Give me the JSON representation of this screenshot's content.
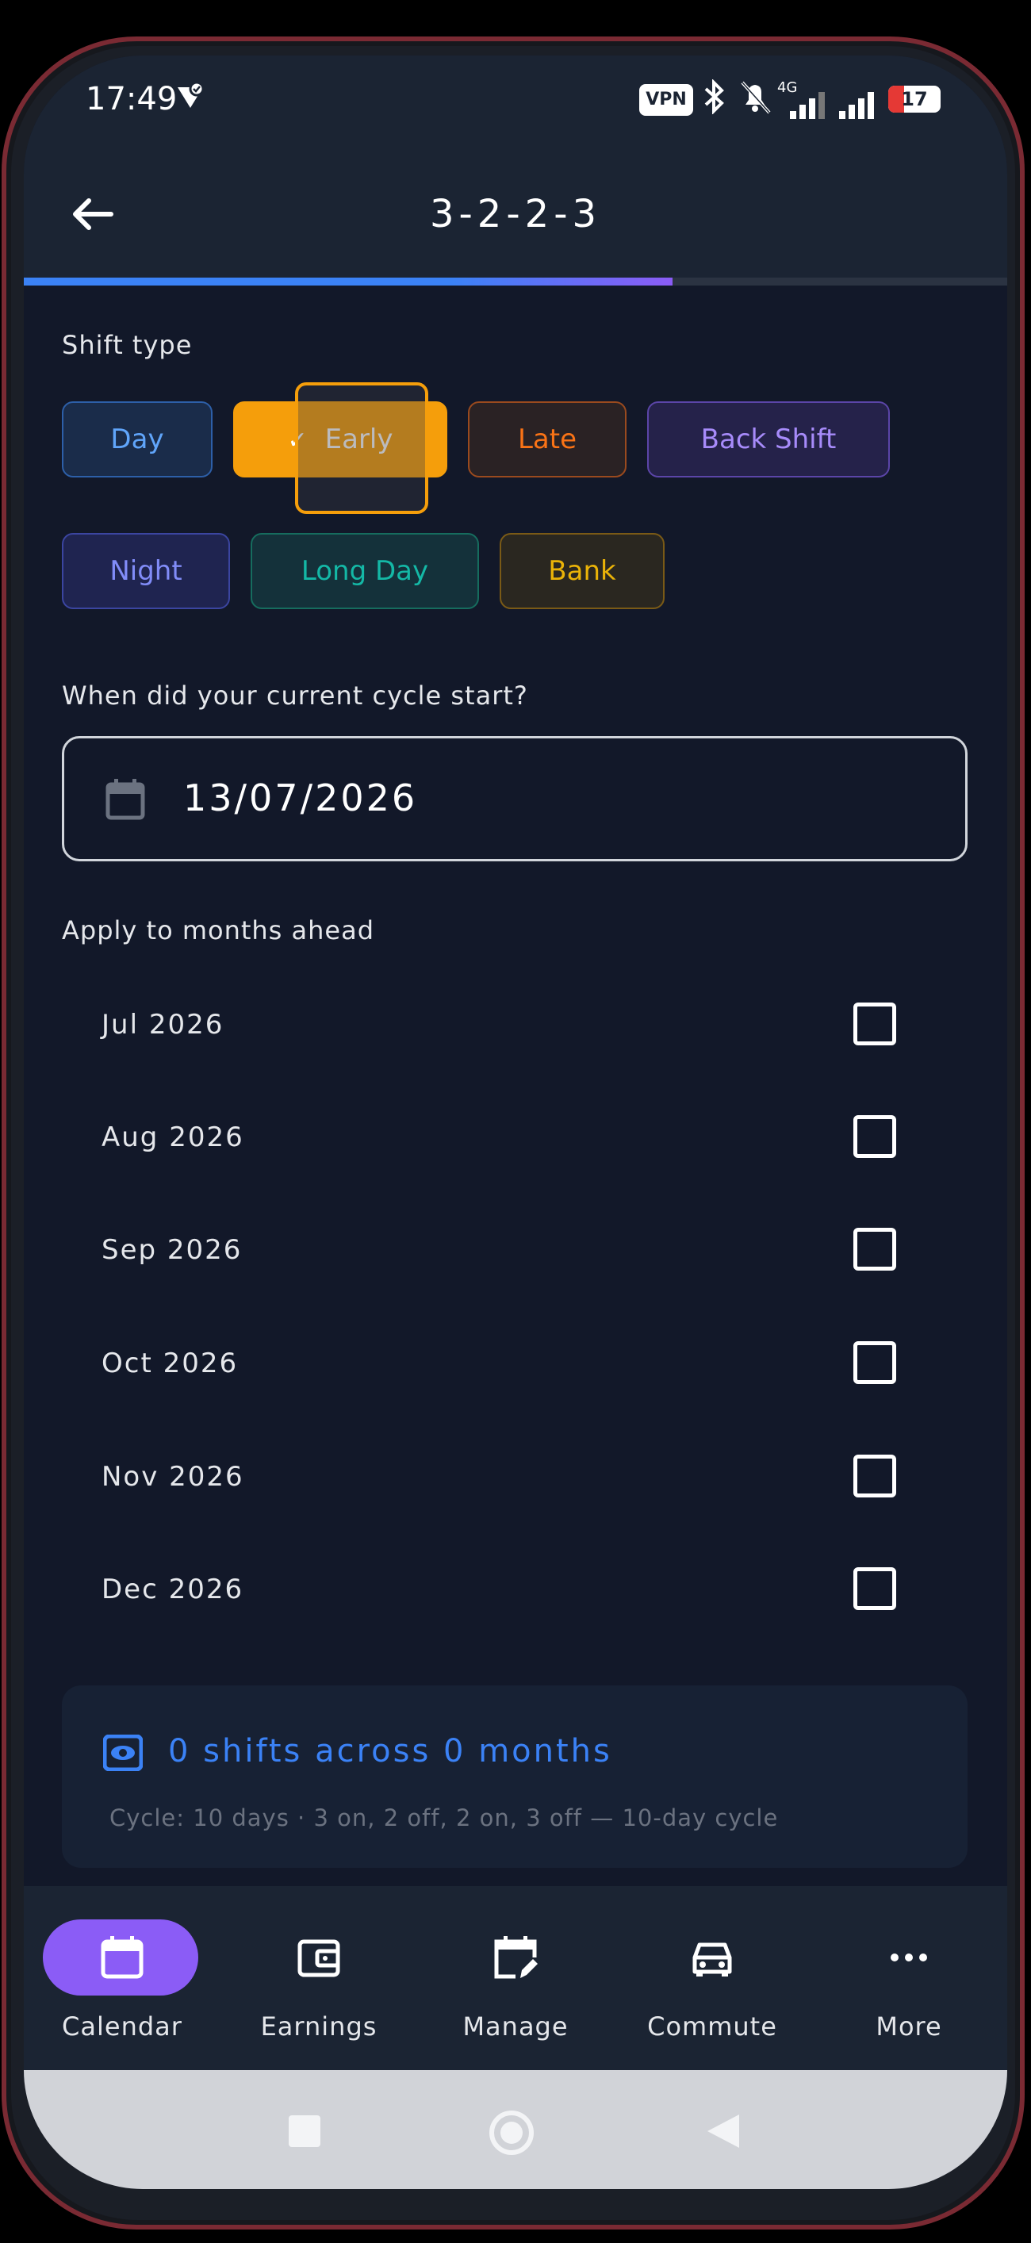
{
  "status_bar": {
    "time": "17:49",
    "vpn_label": "VPN",
    "network": "4G",
    "battery": "17",
    "battery_color": "#e53935"
  },
  "app_bar": {
    "title": "3-2-2-3",
    "back_icon": "arrow-left-icon"
  },
  "progress": {
    "fraction": 0.66
  },
  "shift_type": {
    "label": "Shift type",
    "options": [
      "Day",
      "Early",
      "Late",
      "Back Shift",
      "Night",
      "Long Day",
      "Bank"
    ],
    "selected": "Early",
    "colors": {
      "Day": "#60a5fa",
      "Early": "#f59e0b",
      "Late": "#f97316",
      "Back Shift": "#a78bfa",
      "Night": "#818cf8",
      "Long Day": "#14b8a6",
      "Bank": "#eab308"
    }
  },
  "cycle_start": {
    "label": "When did your current cycle start?",
    "value": "13/07/2026",
    "icon": "calendar-icon"
  },
  "months": {
    "label": "Apply to months ahead",
    "items": [
      {
        "label": "Jul 2026",
        "checked": false
      },
      {
        "label": "Aug 2026",
        "checked": false
      },
      {
        "label": "Sep 2026",
        "checked": false
      },
      {
        "label": "Oct 2026",
        "checked": false
      },
      {
        "label": "Nov 2026",
        "checked": false
      },
      {
        "label": "Dec 2026",
        "checked": false
      }
    ]
  },
  "summary": {
    "title": "0 shifts across 0 months",
    "detail": "Cycle: 10 days · 3 on, 2 off, 2 on, 3 off — 10-day cycle",
    "icon": "eye-icon"
  },
  "bottom_nav": {
    "items": [
      {
        "label": "Calendar",
        "icon": "calendar-icon",
        "active": true
      },
      {
        "label": "Earnings",
        "icon": "wallet-icon",
        "active": false
      },
      {
        "label": "Manage",
        "icon": "calendar-edit-icon",
        "active": false
      },
      {
        "label": "Commute",
        "icon": "car-icon",
        "active": false
      },
      {
        "label": "More",
        "icon": "more-icon",
        "active": false
      }
    ],
    "active_color": "#8b5cf6"
  },
  "system_nav": {
    "icons": [
      "recents-icon",
      "home-icon",
      "back-icon"
    ]
  }
}
